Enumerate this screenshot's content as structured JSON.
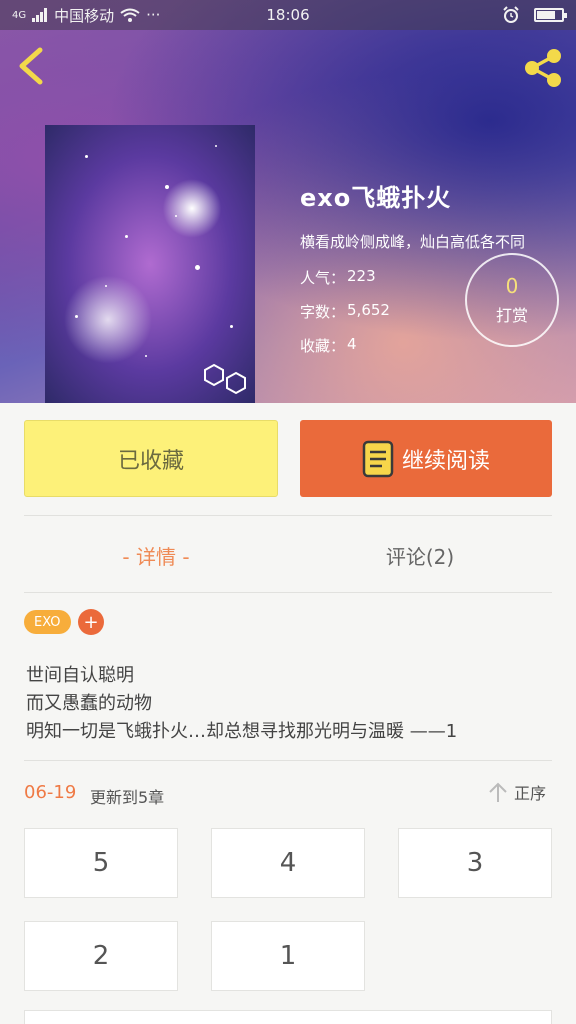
{
  "status_bar": {
    "carrier": "中国移动",
    "network": "4G",
    "more": "···",
    "time": "18:06"
  },
  "book": {
    "title": "exo飞蛾扑火",
    "intro": "横看成岭侧成峰，灿白高低各不同",
    "popularity_label": "人气：",
    "popularity_value": "223",
    "words_label": "字数：",
    "words_value": "5,652",
    "favorites_label": "收藏：",
    "favorites_value": "4"
  },
  "reward": {
    "count": "0",
    "label": "打赏"
  },
  "actions": {
    "collected_label": "已收藏",
    "continue_label": "继续阅读"
  },
  "tabs": [
    {
      "label": "- 详情 -",
      "active": true
    },
    {
      "label": "评论(2)",
      "active": false
    }
  ],
  "tags": [
    {
      "label": "EXO"
    }
  ],
  "add_tag_label": "+",
  "description": [
    "世间自认聪明",
    "而又愚蠢的动物",
    "明知一切是飞蛾扑火…却总想寻找那光明与温暖 ——1"
  ],
  "update": {
    "date": "06-19",
    "text": "更新到5章",
    "sort_label": "正序"
  },
  "chapters": [
    "5",
    "4",
    "3",
    "2",
    "1"
  ],
  "colors": {
    "accent_orange": "#ea6a3b",
    "collected_yellow": "#fdf179",
    "tab_active": "#ef8a55",
    "tag_orange": "#f7ad3b"
  },
  "icons": [
    "signal-icon",
    "wifi-icon",
    "alarm-icon",
    "battery-icon",
    "back-arrow-icon",
    "share-icon",
    "book-icon",
    "sort-arrow-icon"
  ]
}
